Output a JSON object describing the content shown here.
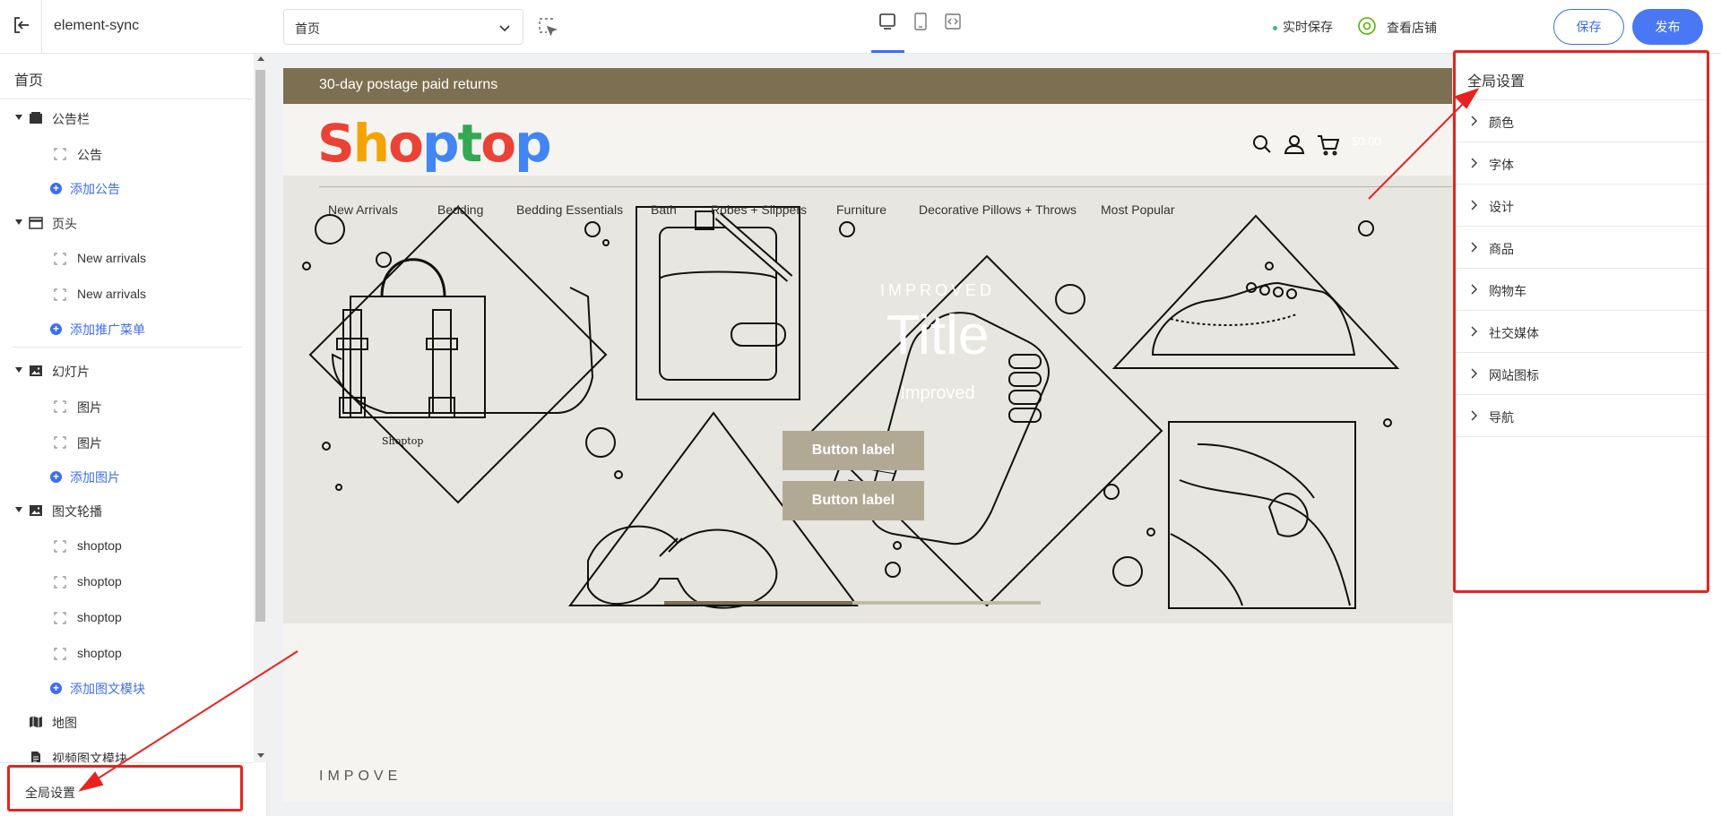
{
  "topbar": {
    "app_title": "element-sync",
    "page_select": {
      "value": "首页"
    },
    "autosave": "实时保存",
    "view_store": "查看店铺",
    "save": "保存",
    "publish": "发布"
  },
  "sidebar": {
    "title": "首页",
    "groups": {
      "announcement": {
        "label": "公告栏",
        "children": [
          "公告"
        ],
        "add": "添加公告"
      },
      "header": {
        "label": "页头",
        "children": [
          "New arrivals",
          "New arrivals"
        ],
        "add": "添加推广菜单"
      },
      "slideshow": {
        "label": "幻灯片",
        "children": [
          "图片",
          "图片"
        ],
        "add": "添加图片"
      },
      "carousel": {
        "label": "图文轮播",
        "children": [
          "shoptop",
          "shoptop",
          "shoptop",
          "shoptop"
        ],
        "add": "添加图文模块"
      },
      "map": {
        "label": "地图"
      },
      "video": {
        "label": "视频图文模块"
      }
    },
    "global_settings": "全局设置"
  },
  "preview": {
    "announcement": "30-day postage paid returns",
    "logo": {
      "letters": [
        "S",
        "h",
        "o",
        "p",
        "t",
        "o",
        "p"
      ],
      "colors": [
        "#ea4335",
        "#f4a300",
        "#ea4335",
        "#4285f4",
        "#34a853",
        "#ea4335",
        "#4285f4"
      ]
    },
    "cart_amount": "$0.00",
    "nav": [
      "New Arrivals",
      "Bedding",
      "Bedding Essentials",
      "Bath",
      "Robes + Slippers",
      "Furniture",
      "Decorative Pillows + Throws",
      "Most Popular"
    ],
    "hero": {
      "eyebrow": "IMPROVED",
      "title": "Title",
      "subtitle": "Improved",
      "buttons": [
        "Button label",
        "Button label"
      ],
      "bag_brand": "Shoptop",
      "slide_progress": 0.5
    },
    "below_text": "IMPOVE"
  },
  "right_panel": {
    "title": "全局设置",
    "items": [
      "颜色",
      "字体",
      "设计",
      "商品",
      "购物车",
      "社交媒体",
      "网站图标",
      "导航"
    ]
  },
  "colors": {
    "accent": "#3c6ef0",
    "announcement_bg": "#7d7052",
    "highlight": "#e8231f"
  }
}
